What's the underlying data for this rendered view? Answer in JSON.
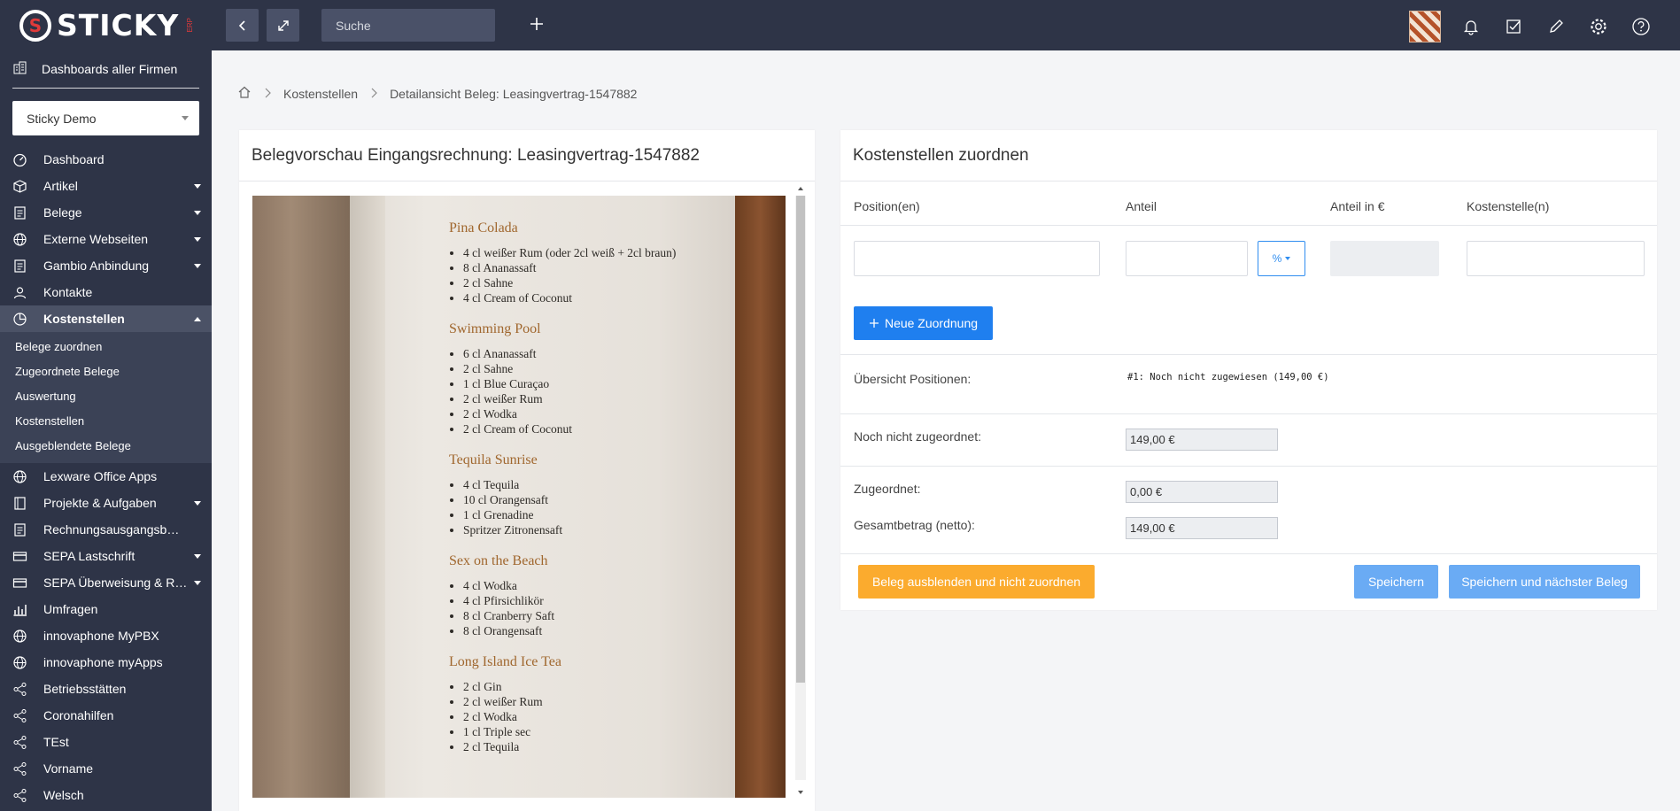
{
  "app": {
    "brand": "STICKY",
    "brand_sub": "ERP",
    "search_placeholder": "Suche"
  },
  "sidebar": {
    "top_item": "Dashboards aller Firmen",
    "company": "Sticky Demo",
    "items": [
      {
        "label": "Dashboard",
        "icon": "dashboard-icon",
        "has_chevron": false
      },
      {
        "label": "Artikel",
        "icon": "box-icon",
        "has_chevron": true
      },
      {
        "label": "Belege",
        "icon": "document-icon",
        "has_chevron": true
      },
      {
        "label": "Externe Webseiten",
        "icon": "globe-icon",
        "has_chevron": true
      },
      {
        "label": "Gambio Anbindung",
        "icon": "document-icon",
        "has_chevron": true
      },
      {
        "label": "Kontakte",
        "icon": "contacts-icon",
        "has_chevron": false
      },
      {
        "label": "Kostenstellen",
        "icon": "pie-chart-icon",
        "has_chevron": true,
        "active": true
      }
    ],
    "sub_items": [
      "Belege zuordnen",
      "Zugeordnete Belege",
      "Auswertung",
      "Kostenstellen",
      "Ausgeblendete Belege"
    ],
    "items_after": [
      {
        "label": "Lexware Office Apps",
        "icon": "globe-icon",
        "has_chevron": false
      },
      {
        "label": "Projekte & Aufgaben",
        "icon": "book-icon",
        "has_chevron": true
      },
      {
        "label": "Rechnungsausgangsb…",
        "icon": "document-icon",
        "has_chevron": false
      },
      {
        "label": "SEPA Lastschrift",
        "icon": "card-icon",
        "has_chevron": true
      },
      {
        "label": "SEPA Überweisung & R…",
        "icon": "card-icon",
        "has_chevron": true
      },
      {
        "label": "Umfragen",
        "icon": "bar-chart-icon",
        "has_chevron": false
      },
      {
        "label": "innovaphone MyPBX",
        "icon": "globe-icon",
        "has_chevron": false
      },
      {
        "label": "innovaphone myApps",
        "icon": "globe-icon",
        "has_chevron": false
      },
      {
        "label": "Betriebsstätten",
        "icon": "share-icon",
        "has_chevron": false
      },
      {
        "label": "Coronahilfen",
        "icon": "share-icon",
        "has_chevron": false
      },
      {
        "label": "TEst",
        "icon": "share-icon",
        "has_chevron": false
      },
      {
        "label": "Vorname",
        "icon": "share-icon",
        "has_chevron": false
      },
      {
        "label": "Welsch",
        "icon": "share-icon",
        "has_chevron": false
      }
    ]
  },
  "breadcrumb": {
    "items": [
      "Kostenstellen",
      "Detailansicht Beleg: Leasingvertrag-1547882"
    ]
  },
  "preview": {
    "title": "Belegvorschau Eingangsrechnung: Leasingvertrag-1547882",
    "recipes": [
      {
        "name": "Pina Colada",
        "lines": [
          "4 cl weißer Rum (oder 2cl weiß + 2cl braun)",
          "8 cl Ananassaft",
          "2 cl Sahne",
          "4 cl Cream of Coconut"
        ]
      },
      {
        "name": "Swimming Pool",
        "lines": [
          "6 cl Ananassaft",
          "2 cl Sahne",
          "1 cl Blue Curaçao",
          "2 cl weißer Rum",
          "2 cl Wodka",
          "2 cl Cream of Coconut"
        ]
      },
      {
        "name": "Tequila Sunrise",
        "lines": [
          "4 cl Tequila",
          "10 cl Orangensaft",
          "1 cl Grenadine",
          "Spritzer Zitronensaft"
        ]
      },
      {
        "name": "Sex on the Beach",
        "lines": [
          "4 cl Wodka",
          "4 cl Pfirsichlikör",
          "8 cl Cranberry Saft",
          "8 cl Orangensaft"
        ]
      },
      {
        "name": "Long Island Ice Tea",
        "lines": [
          "2 cl Gin",
          "2 cl weißer Rum",
          "2 cl Wodka",
          "1 cl Triple sec",
          "2 cl Tequila"
        ]
      }
    ]
  },
  "allocation": {
    "title": "Kostenstellen zuordnen",
    "columns": [
      "Position(en)",
      "Anteil",
      "Anteil in €",
      "Kostenstelle(n)"
    ],
    "unit_selected": "%",
    "new_button": "Neue Zuordnung",
    "overview_label": "Übersicht Positionen:",
    "overview_value": "#1: Noch nicht zugewiesen (149,00 €)",
    "not_assigned_label": "Noch nicht zugeordnet:",
    "not_assigned_value": "149,00 €",
    "assigned_label": "Zugeordnet:",
    "assigned_value": "0,00 €",
    "total_label": "Gesamtbetrag (netto):",
    "total_value": "149,00 €",
    "hide_button": "Beleg ausblenden und nicht zuordnen",
    "save_button": "Speichern",
    "save_next_button": "Speichern und nächster Beleg"
  }
}
